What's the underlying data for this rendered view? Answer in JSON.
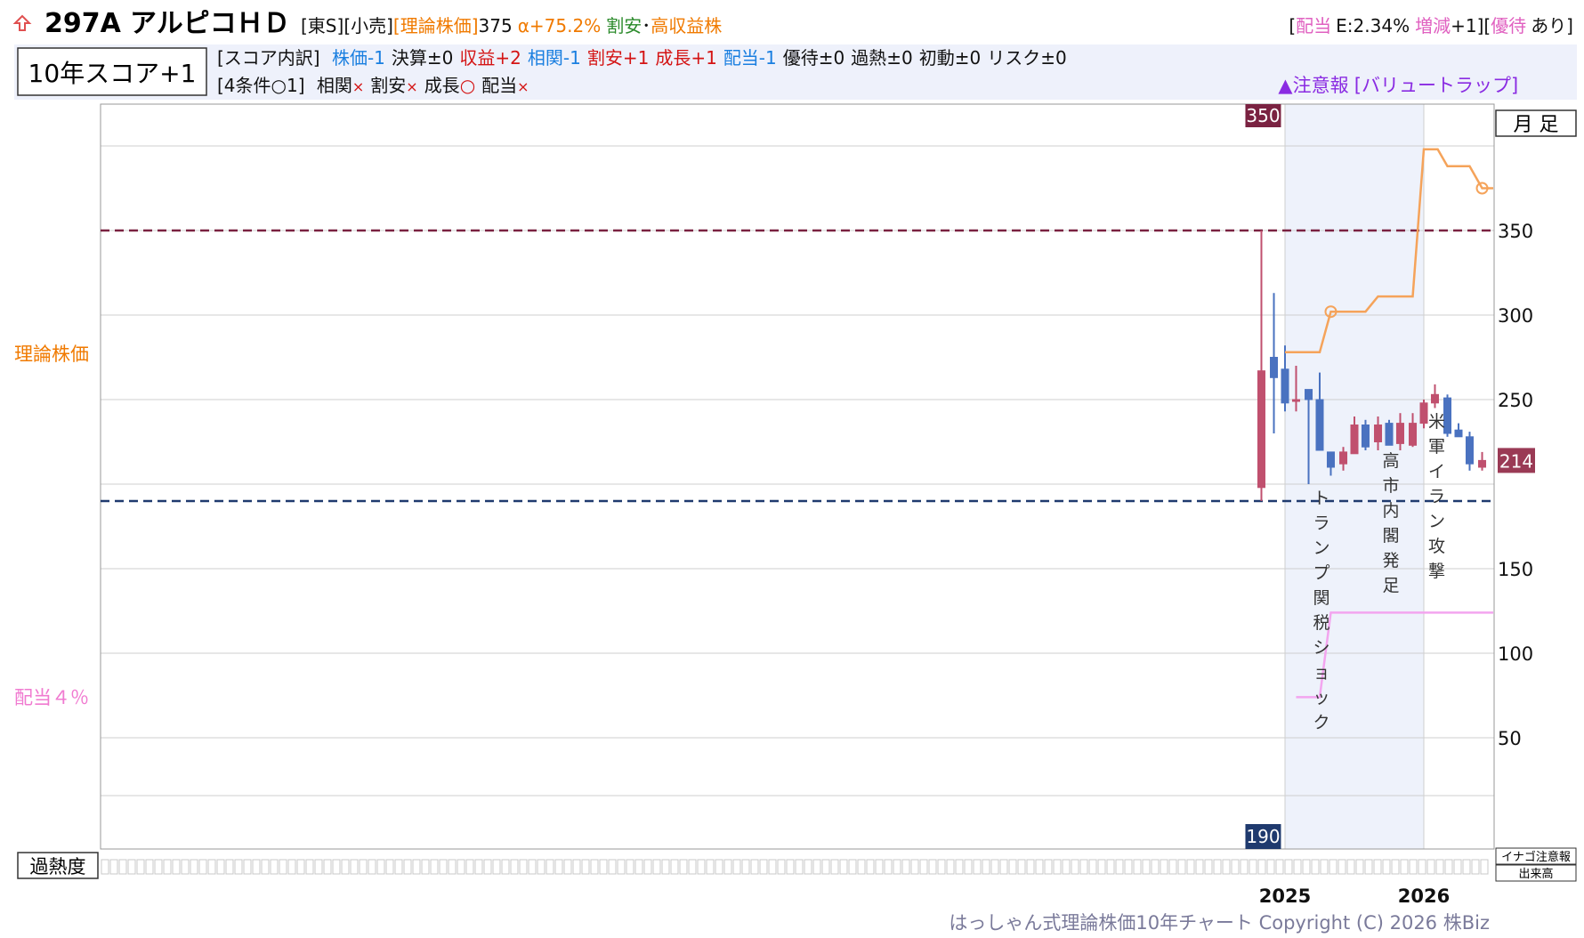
{
  "header": {
    "code": "297A",
    "name": "アルピコＨＤ",
    "market": "[東S]",
    "sector": "[小売]",
    "theory_label": "[理論株価]",
    "theory_value": "375",
    "alpha": "α+75.2%",
    "tag_cheap": "割安",
    "tag_dot": "･",
    "tag_yield": "高収益株",
    "dividend_open": "[",
    "dividend_label": "配当",
    "dividend_value": "E:2.34%",
    "dividend_change_label": "増減",
    "dividend_change_value": "+1][",
    "yutai_label": "優待",
    "yutai_value": "あり]"
  },
  "score": {
    "label": "10年スコア+1",
    "breakdown_prefix": "[スコア内訳]",
    "items": [
      {
        "text": "株価-1",
        "color": "#1a7fe0"
      },
      {
        "text": "決算±0",
        "color": "#111111"
      },
      {
        "text": "収益+2",
        "color": "#d41414"
      },
      {
        "text": "相関-1",
        "color": "#1a7fe0"
      },
      {
        "text": "割安+1",
        "color": "#d41414"
      },
      {
        "text": "成長+1",
        "color": "#d41414"
      },
      {
        "text": "配当-1",
        "color": "#1a7fe0"
      },
      {
        "text": "優待±0",
        "color": "#111111"
      },
      {
        "text": "過熱±0",
        "color": "#111111"
      },
      {
        "text": "初動±0",
        "color": "#111111"
      },
      {
        "text": "リスク±0",
        "color": "#111111"
      }
    ],
    "cond_prefix": "[4条件○1]",
    "conds": [
      {
        "label": "相関",
        "mark": "×",
        "ok": false
      },
      {
        "label": "割安",
        "mark": "×",
        "ok": false
      },
      {
        "label": "成長",
        "mark": "○",
        "ok": true
      },
      {
        "label": "配当",
        "mark": "×",
        "ok": false
      }
    ],
    "warning": "▲注意報",
    "warning_tag": "[バリュートラップ]"
  },
  "chart_data": {
    "type": "candlestick",
    "period_label": "月 足",
    "y_ticks": [
      50,
      100,
      150,
      250,
      300,
      350
    ],
    "x_labels": [
      {
        "label": "2025",
        "x": 2025.0
      },
      {
        "label": "2026",
        "x": 2026.0
      }
    ],
    "left_labels": {
      "theory": "理論株価",
      "dividend": "配当４％"
    },
    "high_marker": "350",
    "low_marker": "190",
    "last_price": "214",
    "high_line": 350,
    "low_line": 190,
    "months": [
      2024.83,
      2024.92,
      2025.0,
      2025.08,
      2025.17,
      2025.25,
      2025.33,
      2025.42,
      2025.5,
      2025.58,
      2025.67,
      2025.75,
      2025.83,
      2025.92,
      2026.0,
      2026.08,
      2026.17,
      2026.25,
      2026.33,
      2026.42
    ],
    "candles": [
      {
        "o": 198,
        "h": 350,
        "l": 190,
        "c": 267
      },
      {
        "o": 275,
        "h": 313,
        "l": 230,
        "c": 263
      },
      {
        "o": 268,
        "h": 282,
        "l": 243,
        "c": 248
      },
      {
        "o": 249,
        "h": 270,
        "l": 243,
        "c": 250
      },
      {
        "o": 256,
        "h": 256,
        "l": 200,
        "c": 250
      },
      {
        "o": 250,
        "h": 266,
        "l": 220,
        "c": 220
      },
      {
        "o": 219,
        "h": 219,
        "l": 205,
        "c": 210
      },
      {
        "o": 212,
        "h": 222,
        "l": 208,
        "c": 219
      },
      {
        "o": 218,
        "h": 240,
        "l": 218,
        "c": 235
      },
      {
        "o": 235,
        "h": 238,
        "l": 220,
        "c": 222
      },
      {
        "o": 225,
        "h": 240,
        "l": 220,
        "c": 235
      },
      {
        "o": 236,
        "h": 238,
        "l": 223,
        "c": 223
      },
      {
        "o": 224,
        "h": 242,
        "l": 220,
        "c": 236
      },
      {
        "o": 223,
        "h": 242,
        "l": 222,
        "c": 236
      },
      {
        "o": 236,
        "h": 250,
        "l": 233,
        "c": 248
      },
      {
        "o": 248,
        "h": 259,
        "l": 245,
        "c": 253
      },
      {
        "o": 251,
        "h": 253,
        "l": 228,
        "c": 230
      },
      {
        "o": 232,
        "h": 236,
        "l": 228,
        "c": 228
      },
      {
        "o": 228,
        "h": 231,
        "l": 208,
        "c": 212
      },
      {
        "o": 210,
        "h": 219,
        "l": 208,
        "c": 214
      }
    ],
    "theory_line": [
      {
        "x": 2025.0,
        "y": 278
      },
      {
        "x": 2025.25,
        "y": 278
      },
      {
        "x": 2025.33,
        "y": 302
      },
      {
        "x": 2025.58,
        "y": 302
      },
      {
        "x": 2025.67,
        "y": 311
      },
      {
        "x": 2025.92,
        "y": 311
      },
      {
        "x": 2026.0,
        "y": 398
      },
      {
        "x": 2026.1,
        "y": 398
      },
      {
        "x": 2026.17,
        "y": 388
      },
      {
        "x": 2026.33,
        "y": 388
      },
      {
        "x": 2026.42,
        "y": 375
      },
      {
        "x": 2026.5,
        "y": 375
      }
    ],
    "theory_points": [
      {
        "x": 2025.33,
        "y": 302
      },
      {
        "x": 2026.42,
        "y": 375
      }
    ],
    "dividend_line": [
      {
        "x": 2025.08,
        "y": 74
      },
      {
        "x": 2025.25,
        "y": 74
      },
      {
        "x": 2025.33,
        "y": 124
      },
      {
        "x": 2026.5,
        "y": 124
      }
    ],
    "events": [
      {
        "x": 2025.25,
        "text": "トランプ関税ショック"
      },
      {
        "x": 2025.75,
        "text": "高市内閣発足"
      },
      {
        "x": 2026.08,
        "text": "米軍イラン攻撃"
      }
    ],
    "shade": {
      "x0": 2025.0,
      "x1": 2026.0
    },
    "heat_label": "過熱度",
    "right_badge_top": "イナゴ注意報",
    "right_badge_bottom": "出来高",
    "colors": {
      "up": "#c0506e",
      "down": "#4a72c0",
      "theory": "#f5a35a",
      "dividend": "#f3a5ef",
      "high": "#7a2241",
      "low": "#1f3a6e",
      "shade": "#eef2fb"
    }
  },
  "footer": "はっしゃん式理論株価10年チャート Copyright (C) 2026 株Biz"
}
